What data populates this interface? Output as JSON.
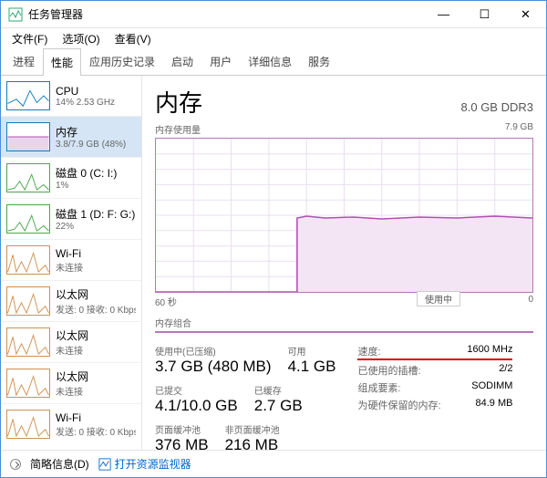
{
  "window": {
    "title": "任务管理器",
    "min": "—",
    "max": "☐",
    "close": "✕"
  },
  "menu": {
    "file": "文件(F)",
    "options": "选项(O)",
    "view": "查看(V)"
  },
  "tabs": [
    "进程",
    "性能",
    "应用历史记录",
    "启动",
    "用户",
    "详细信息",
    "服务"
  ],
  "activeTab": 1,
  "sidebar": [
    {
      "title": "CPU",
      "sub": "14% 2.53 GHz",
      "kind": "cpu"
    },
    {
      "title": "内存",
      "sub": "3.8/7.9 GB (48%)",
      "kind": "mem",
      "selected": true
    },
    {
      "title": "磁盘 0 (C: I:)",
      "sub": "1%",
      "kind": "disk"
    },
    {
      "title": "磁盘 1 (D: F: G:)",
      "sub": "22%",
      "kind": "disk"
    },
    {
      "title": "Wi-Fi",
      "sub": "未连接",
      "kind": "net"
    },
    {
      "title": "以太网",
      "sub": "发送: 0 接收: 0 Kbps",
      "kind": "net"
    },
    {
      "title": "以太网",
      "sub": "未连接",
      "kind": "net"
    },
    {
      "title": "以太网",
      "sub": "未连接",
      "kind": "net"
    },
    {
      "title": "Wi-Fi",
      "sub": "发送: 0 接收: 0 Kbps",
      "kind": "net"
    }
  ],
  "main": {
    "title": "内存",
    "spec": "8.0 GB DDR3",
    "usageLabel": "内存使用量",
    "usageMax": "7.9 GB",
    "xLeft": "60 秒",
    "xRight": "0",
    "inUseLabel": "使用中",
    "compLabel": "内存组合"
  },
  "stats": {
    "usedLabel": "使用中(已压缩)",
    "usedVal": "3.7 GB (480 MB)",
    "availLabel": "可用",
    "availVal": "4.1 GB",
    "committedLabel": "已提交",
    "committedVal": "4.1/10.0 GB",
    "cachedLabel": "已缓存",
    "cachedVal": "2.7 GB",
    "pagedLabel": "页面缓冲池",
    "pagedVal": "376 MB",
    "nonpagedLabel": "非页面缓冲池",
    "nonpagedVal": "216 MB"
  },
  "kv": {
    "speed_k": "速度:",
    "speed_v": "1600 MHz",
    "slots_k": "已使用的插槽:",
    "slots_v": "2/2",
    "form_k": "组成要素:",
    "form_v": "SODIMM",
    "hw_k": "为硬件保留的内存:",
    "hw_v": "84.9 MB"
  },
  "chart_data": {
    "type": "area",
    "title": "内存使用量",
    "ylabel": "GB",
    "ylim": [
      0,
      7.9
    ],
    "xlabel": "秒",
    "xlim": [
      60,
      0
    ],
    "series": [
      {
        "name": "使用中",
        "x": [
          60,
          55,
          50,
          45,
          40,
          38,
          35,
          30,
          25,
          20,
          15,
          10,
          5,
          0
        ],
        "values": [
          0,
          0,
          0,
          0,
          0,
          0,
          3.8,
          3.8,
          3.8,
          3.8,
          3.8,
          3.8,
          3.8,
          3.8
        ]
      }
    ]
  },
  "footer": {
    "brief": "简略信息(D)",
    "resmon": "打开资源监视器"
  }
}
